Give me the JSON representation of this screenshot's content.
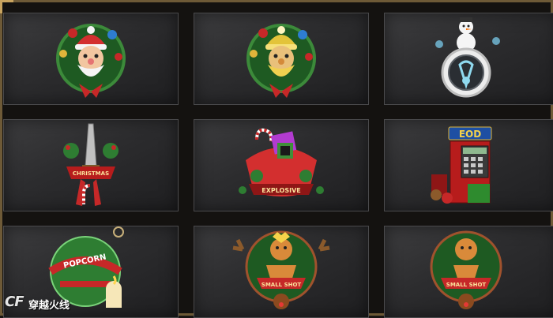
{
  "logo": {
    "mark": "CF",
    "name": "穿越火线"
  },
  "badges": [
    {
      "id": "santa-red",
      "text": ""
    },
    {
      "id": "santa-gold",
      "text": ""
    },
    {
      "id": "snowman",
      "text": ""
    },
    {
      "id": "knife",
      "text": "CHRISTMAS"
    },
    {
      "id": "explosive",
      "text": "EXPLOSIVE"
    },
    {
      "id": "eod",
      "text": "EOD"
    },
    {
      "id": "popcorn",
      "text": "POPCORN"
    },
    {
      "id": "gingerbread-1",
      "text": "SMALL SHOT"
    },
    {
      "id": "gingerbread-2",
      "text": "SMALL SHOT"
    }
  ],
  "colors": {
    "accent_gold": "#c9a45f",
    "frame": "#6e5a37",
    "tile": "#2c2c2e"
  }
}
